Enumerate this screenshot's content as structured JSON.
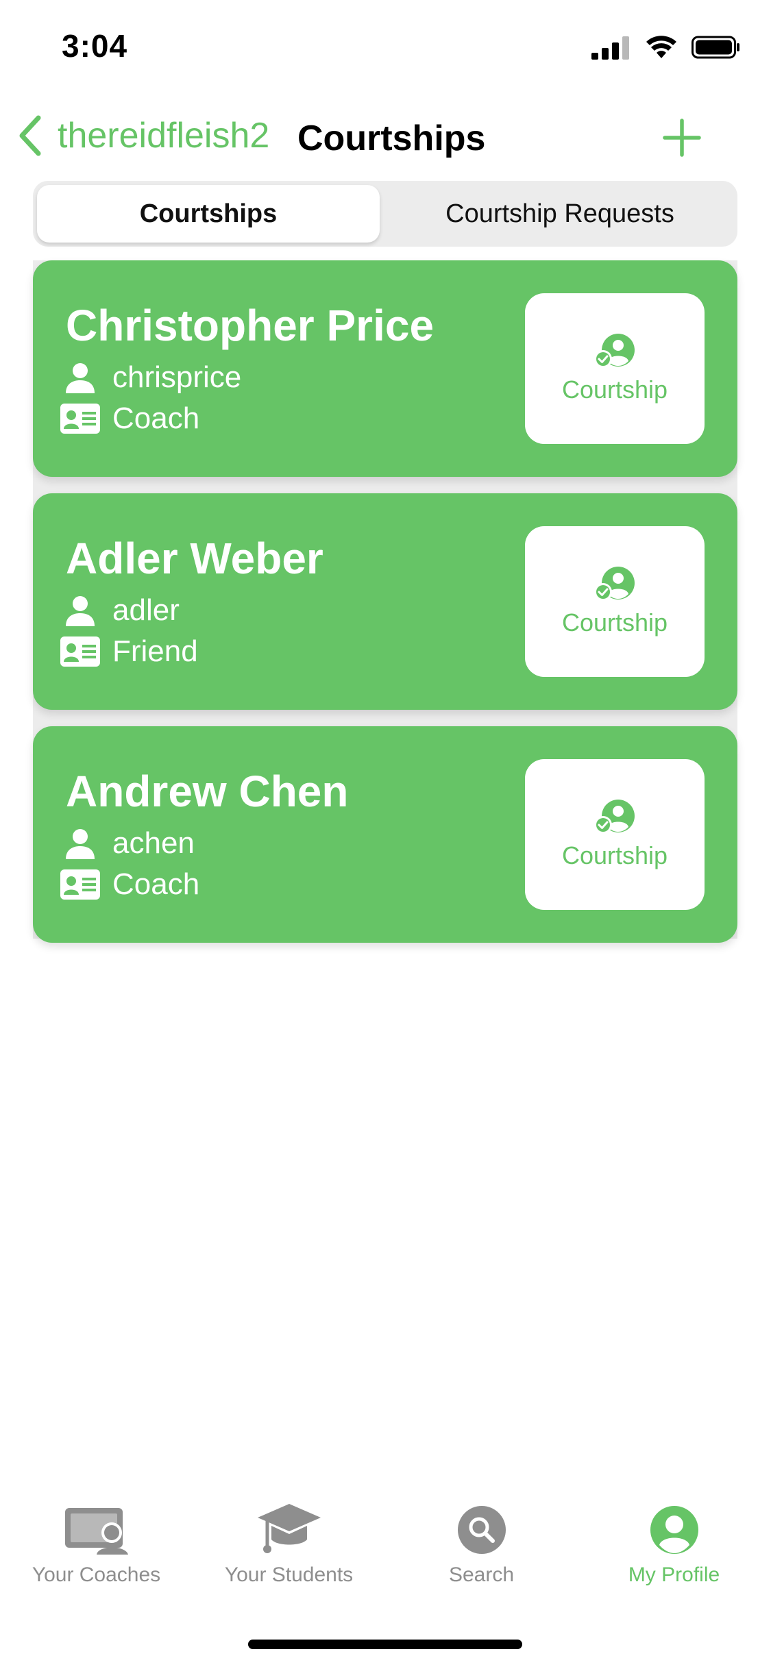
{
  "status_bar": {
    "time": "3:04"
  },
  "nav": {
    "back_label": "thereidfleish2",
    "title": "Courtships"
  },
  "segmented": {
    "options": [
      "Courtships",
      "Courtship Requests"
    ],
    "selected": "Courtships"
  },
  "courtships": [
    {
      "name": "Christopher Price",
      "username": "chrisprice",
      "role": "Coach",
      "button_label": "Courtship"
    },
    {
      "name": "Adler Weber",
      "username": "adler",
      "role": "Friend",
      "button_label": "Courtship"
    },
    {
      "name": "Andrew Chen",
      "username": "achen",
      "role": "Coach",
      "button_label": "Courtship"
    }
  ],
  "tabbar": {
    "items": [
      {
        "label": "Your Coaches",
        "icon": "coaches-icon"
      },
      {
        "label": "Your Students",
        "icon": "graduation-cap-icon"
      },
      {
        "label": "Search",
        "icon": "search-icon"
      },
      {
        "label": "My Profile",
        "icon": "profile-icon"
      }
    ],
    "active": "My Profile"
  },
  "colors": {
    "accent": "#66c466",
    "tab_inactive": "#8e8e8e",
    "segment_bg": "#ececec"
  }
}
